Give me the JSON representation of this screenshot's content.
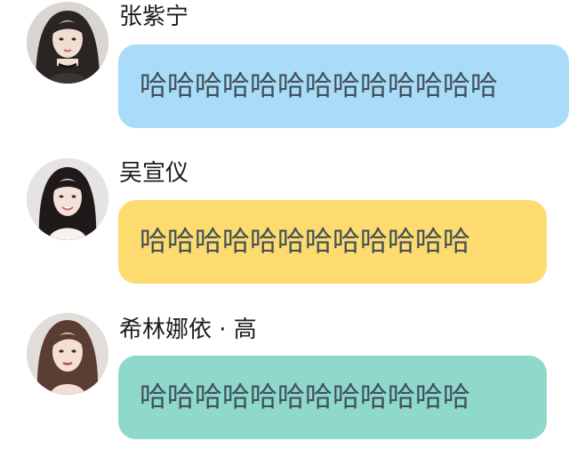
{
  "messages": [
    {
      "sender": "张紫宁",
      "text": "哈哈哈哈哈哈哈哈哈哈哈哈哈",
      "bubble_color": "#a8dcf8",
      "avatar_icon": "avatar-photo"
    },
    {
      "sender": "吴宣仪",
      "text": "哈哈哈哈哈哈哈哈哈哈哈哈",
      "bubble_color": "#fddb6e",
      "avatar_icon": "avatar-photo"
    },
    {
      "sender": "希林娜依 · 高",
      "text": "哈哈哈哈哈哈哈哈哈哈哈哈",
      "bubble_color": "#8ed9cb",
      "avatar_icon": "avatar-photo"
    }
  ]
}
